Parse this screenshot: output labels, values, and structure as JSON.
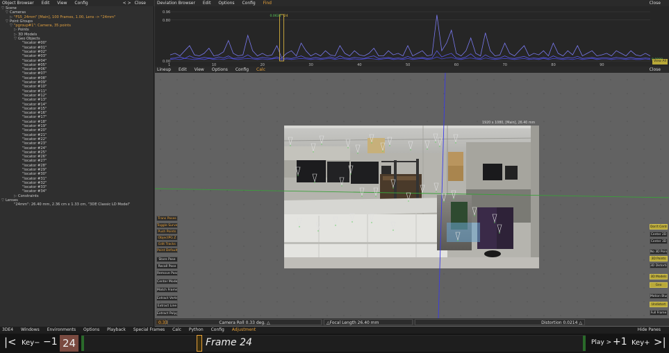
{
  "object_browser": {
    "title": "Object Browser",
    "menus": [
      "Edit",
      "View",
      "Config"
    ],
    "nav": "< >",
    "close": "Close",
    "tree": [
      {
        "indent": 0,
        "text": "Scene",
        "tri": "▽",
        "style": "normal"
      },
      {
        "indent": 1,
        "text": "Cameras",
        "tri": "▽",
        "style": "normal"
      },
      {
        "indent": 2,
        "text": "\"FS5_24mm\" [Main], 100 Frames, 1.00, Lens -> \"24mm\"",
        "tri": "▷",
        "style": "orange"
      },
      {
        "indent": 1,
        "text": "Point Groups",
        "tri": "▽",
        "style": "normal"
      },
      {
        "indent": 2,
        "text": "\"pgroup#1\": Camera, 35 points",
        "tri": "▽",
        "style": "orange"
      },
      {
        "indent": 3,
        "text": "Points",
        "tri": "▷",
        "style": "normal"
      },
      {
        "indent": 3,
        "text": "3D Models",
        "tri": "▷",
        "style": "normal"
      },
      {
        "indent": 3,
        "text": "Geo Objects",
        "tri": "▽",
        "style": "normal"
      },
      {
        "indent": 4,
        "text": "\"locator #00\"",
        "tri": "",
        "style": "normal"
      },
      {
        "indent": 4,
        "text": "\"locator #01\"",
        "tri": "",
        "style": "normal"
      },
      {
        "indent": 4,
        "text": "\"locator #02\"",
        "tri": "",
        "style": "normal"
      },
      {
        "indent": 4,
        "text": "\"locator #03\"",
        "tri": "",
        "style": "normal"
      },
      {
        "indent": 4,
        "text": "\"locator #04\"",
        "tri": "",
        "style": "normal"
      },
      {
        "indent": 4,
        "text": "\"locator #05\"",
        "tri": "",
        "style": "normal"
      },
      {
        "indent": 4,
        "text": "\"locator #06\"",
        "tri": "",
        "style": "normal"
      },
      {
        "indent": 4,
        "text": "\"locator #07\"",
        "tri": "",
        "style": "normal"
      },
      {
        "indent": 4,
        "text": "\"locator #08\"",
        "tri": "",
        "style": "normal"
      },
      {
        "indent": 4,
        "text": "\"locator #09\"",
        "tri": "",
        "style": "normal"
      },
      {
        "indent": 4,
        "text": "\"locator #10\"",
        "tri": "",
        "style": "normal"
      },
      {
        "indent": 4,
        "text": "\"locator #11\"",
        "tri": "",
        "style": "normal"
      },
      {
        "indent": 4,
        "text": "\"locator #12\"",
        "tri": "",
        "style": "normal"
      },
      {
        "indent": 4,
        "text": "\"locator #13\"",
        "tri": "",
        "style": "normal"
      },
      {
        "indent": 4,
        "text": "\"locator #14\"",
        "tri": "",
        "style": "normal"
      },
      {
        "indent": 4,
        "text": "\"locator #15\"",
        "tri": "",
        "style": "normal"
      },
      {
        "indent": 4,
        "text": "\"locator #16\"",
        "tri": "",
        "style": "normal"
      },
      {
        "indent": 4,
        "text": "\"locator #17\"",
        "tri": "",
        "style": "normal"
      },
      {
        "indent": 4,
        "text": "\"locator #18\"",
        "tri": "",
        "style": "normal"
      },
      {
        "indent": 4,
        "text": "\"locator #19\"",
        "tri": "",
        "style": "normal"
      },
      {
        "indent": 4,
        "text": "\"locator #20\"",
        "tri": "",
        "style": "normal"
      },
      {
        "indent": 4,
        "text": "\"locator #21\"",
        "tri": "",
        "style": "normal"
      },
      {
        "indent": 4,
        "text": "\"locator #22\"",
        "tri": "",
        "style": "normal"
      },
      {
        "indent": 4,
        "text": "\"locator #23\"",
        "tri": "",
        "style": "normal"
      },
      {
        "indent": 4,
        "text": "\"locator #24\"",
        "tri": "",
        "style": "normal"
      },
      {
        "indent": 4,
        "text": "\"locator #25\"",
        "tri": "",
        "style": "normal"
      },
      {
        "indent": 4,
        "text": "\"locator #26\"",
        "tri": "",
        "style": "normal"
      },
      {
        "indent": 4,
        "text": "\"locator #27\"",
        "tri": "",
        "style": "normal"
      },
      {
        "indent": 4,
        "text": "\"locator #28\"",
        "tri": "",
        "style": "normal"
      },
      {
        "indent": 4,
        "text": "\"locator #29\"",
        "tri": "",
        "style": "normal"
      },
      {
        "indent": 4,
        "text": "\"locator #30\"",
        "tri": "",
        "style": "normal"
      },
      {
        "indent": 4,
        "text": "\"locator #31\"",
        "tri": "",
        "style": "normal"
      },
      {
        "indent": 4,
        "text": "\"locator #32\"",
        "tri": "",
        "style": "normal"
      },
      {
        "indent": 4,
        "text": "\"locator #33\"",
        "tri": "",
        "style": "normal"
      },
      {
        "indent": 4,
        "text": "\"locator #34\"",
        "tri": "",
        "style": "normal"
      },
      {
        "indent": 3,
        "text": "Constraints",
        "tri": "▷",
        "style": "normal"
      },
      {
        "indent": 0,
        "text": "Lenses",
        "tri": "▽",
        "style": "normal"
      },
      {
        "indent": 2,
        "text": "\"24mm\": 26.40 mm, 2.36 cm x 1.33 cm, \"3DE Classic LD Model\"",
        "tri": "",
        "style": "normal"
      }
    ]
  },
  "deviation_browser": {
    "title": "Deviation Browser",
    "menus": [
      "Edit",
      "Options",
      "Config"
    ],
    "find": "Find",
    "close": "Close",
    "y_labels": [
      "0.96",
      "0.80",
      "0.00"
    ],
    "x_labels": [
      "1",
      "10",
      "20",
      "30",
      "40",
      "50",
      "60",
      "70",
      "80",
      "90"
    ],
    "marker_value": "0.0631",
    "marker_frame": "24",
    "right_value": "0.0008",
    "view_all": "View All"
  },
  "chart_data": {
    "type": "line",
    "title": "",
    "xlabel": "",
    "ylabel": "",
    "xlim": [
      1,
      100
    ],
    "ylim": [
      0,
      0.96
    ],
    "x_ticks": [
      1,
      10,
      20,
      30,
      40,
      50,
      60,
      70,
      80,
      90
    ],
    "y_ticks": [
      0.0,
      0.8,
      0.96
    ],
    "current_frame": 24,
    "series": [
      {
        "values": [
          0.12,
          0.15,
          0.1,
          0.2,
          0.3,
          0.12,
          0.1,
          0.15,
          0.25,
          0.1,
          0.12,
          0.18,
          0.4,
          0.15,
          0.1,
          0.12,
          0.5,
          0.2,
          0.1,
          0.15,
          0.1,
          0.12,
          0.3,
          0.06,
          0.15,
          0.2,
          0.1,
          0.35,
          0.2,
          0.1,
          0.15,
          0.1,
          0.2,
          0.12,
          0.1,
          0.3,
          0.15,
          0.1,
          0.2,
          0.12,
          0.1,
          0.15,
          0.25,
          0.1,
          0.1,
          0.2,
          0.12,
          0.15,
          0.1,
          0.3,
          0.1,
          0.15,
          0.2,
          0.1,
          0.12,
          0.9,
          0.2,
          0.35,
          0.6,
          0.15,
          0.1,
          0.2,
          0.45,
          0.15,
          0.1,
          0.55,
          0.2,
          0.1,
          0.12,
          0.35,
          0.15,
          0.1,
          0.2,
          0.3,
          0.1,
          0.15,
          0.12,
          0.2,
          0.1,
          0.35,
          0.15,
          0.1,
          0.2,
          0.12,
          0.3,
          0.1,
          0.15,
          0.2,
          0.1,
          0.12,
          0.15,
          0.1,
          0.2,
          0.15,
          0.1,
          0.2,
          0.12,
          0.1,
          0.15,
          0.1
        ]
      },
      {
        "values": [
          0.05,
          0.06,
          0.08,
          0.05,
          0.1,
          0.06,
          0.05,
          0.07,
          0.06,
          0.05,
          0.08,
          0.06,
          0.1,
          0.05,
          0.06,
          0.07,
          0.12,
          0.06,
          0.05,
          0.07,
          0.06,
          0.05,
          0.08,
          0.04,
          0.06,
          0.05,
          0.07,
          0.1,
          0.06,
          0.05,
          0.07,
          0.05,
          0.06,
          0.08,
          0.05,
          0.1,
          0.06,
          0.05,
          0.07,
          0.06,
          0.05,
          0.08,
          0.1,
          0.05,
          0.06,
          0.07,
          0.05,
          0.06,
          0.05,
          0.09,
          0.05,
          0.06,
          0.07,
          0.05,
          0.06,
          0.2,
          0.08,
          0.12,
          0.15,
          0.06,
          0.05,
          0.08,
          0.14,
          0.06,
          0.05,
          0.12,
          0.07,
          0.05,
          0.06,
          0.1,
          0.06,
          0.05,
          0.07,
          0.09,
          0.05,
          0.06,
          0.05,
          0.07,
          0.05,
          0.1,
          0.06,
          0.05,
          0.07,
          0.06,
          0.09,
          0.05,
          0.06,
          0.07,
          0.05,
          0.06,
          0.06,
          0.05,
          0.07,
          0.06,
          0.05,
          0.07,
          0.05,
          0.05,
          0.06,
          0.05
        ]
      },
      {
        "values": [
          0.03,
          0.04,
          0.03,
          0.05,
          0.04,
          0.03,
          0.04,
          0.03,
          0.05,
          0.03,
          0.04,
          0.03,
          0.06,
          0.04,
          0.03,
          0.04,
          0.05,
          0.04,
          0.03,
          0.04,
          0.03,
          0.04,
          0.05,
          0.02,
          0.04,
          0.03,
          0.04,
          0.05,
          0.04,
          0.03,
          0.04,
          0.03,
          0.04,
          0.05,
          0.03,
          0.05,
          0.04,
          0.03,
          0.04,
          0.03,
          0.04,
          0.05,
          0.04,
          0.03,
          0.04,
          0.05,
          0.03,
          0.04,
          0.03,
          0.05,
          0.03,
          0.04,
          0.05,
          0.03,
          0.04,
          0.08,
          0.04,
          0.06,
          0.07,
          0.04,
          0.03,
          0.05,
          0.06,
          0.04,
          0.03,
          0.06,
          0.04,
          0.03,
          0.04,
          0.05,
          0.04,
          0.03,
          0.04,
          0.05,
          0.03,
          0.04,
          0.03,
          0.05,
          0.03,
          0.05,
          0.04,
          0.03,
          0.04,
          0.03,
          0.05,
          0.03,
          0.04,
          0.05,
          0.03,
          0.04,
          0.04,
          0.03,
          0.04,
          0.04,
          0.03,
          0.04,
          0.03,
          0.03,
          0.04,
          0.03
        ]
      }
    ]
  },
  "viewport": {
    "menus": [
      "Lineup",
      "Edit",
      "View",
      "Options",
      "Config"
    ],
    "calc": "Calc",
    "close": "Close",
    "photo_title": "1920 x 1080, [Main], 26.40 mm",
    "left_buttons": [
      {
        "label": "Trans Poses",
        "style": "orange"
      },
      {
        "label": "Toggle Survey",
        "style": "orange"
      },
      {
        "label": "Push Points",
        "style": "orange"
      },
      {
        "label": "ObjectPG Z",
        "style": "orange"
      },
      {
        "label": "Edit Tracks",
        "style": "orange"
      },
      {
        "label": "Point Defaults",
        "style": "orange"
      },
      {
        "label": "Store Pose",
        "style": "normal"
      },
      {
        "label": "Recall Pose",
        "style": "normal"
      },
      {
        "label": "Remove Pose",
        "style": "normal"
      },
      {
        "label": "Center Models",
        "style": "normal"
      },
      {
        "label": "Match Frame",
        "style": "normal"
      },
      {
        "label": "Extract Vertex",
        "style": "normal"
      },
      {
        "label": "Extract Line",
        "style": "normal"
      },
      {
        "label": "Extract Polygon",
        "style": "normal"
      }
    ],
    "right_buttons": [
      {
        "label": "Don't Center",
        "style": "yellow"
      },
      {
        "label": "Center 2D",
        "style": "normal"
      },
      {
        "label": "Center 3D",
        "style": "normal"
      },
      {
        "label": "No 3D Points",
        "style": "normal"
      },
      {
        "label": "3D Points",
        "style": "yellow"
      },
      {
        "label": "3D Distortion",
        "style": "normal"
      },
      {
        "label": "3D Models",
        "style": "yellow"
      },
      {
        "label": "Geo",
        "style": "yellow"
      },
      {
        "label": "Motion Blur",
        "style": "normal"
      },
      {
        "label": "Undistort",
        "style": "yellow"
      },
      {
        "label": "Full Frame",
        "style": "normal"
      }
    ],
    "status": {
      "value": "0.33",
      "camera_roll": "Camera Roll 0.33 deg.",
      "focal_length": "Focal Length 26.40 mm",
      "distortion": "Distortion 0.0214"
    }
  },
  "bottom_menu": {
    "items": [
      "3DE4",
      "Windows",
      "Environments",
      "Options",
      "Playback",
      "Special Frames",
      "Calc",
      "Python",
      "Config"
    ],
    "active": "Adjustment",
    "hide_panes": "Hide Panes"
  },
  "timeline": {
    "first_frame": "|<",
    "key_prev": "Key−",
    "step_back": "−1",
    "current": "24",
    "frame_label": "Frame 24",
    "play": "Play >",
    "step_fwd": "+1",
    "key_next": "Key+",
    "last_frame": ">|"
  },
  "colors": {
    "accent_orange": "#e8a23a",
    "accent_yellow": "#b8a838",
    "curve_blue": "#6a6af0",
    "axis_green": "#3aa03a",
    "axis_blue": "#3a3ae8",
    "frame_red": "#7a4a40"
  }
}
